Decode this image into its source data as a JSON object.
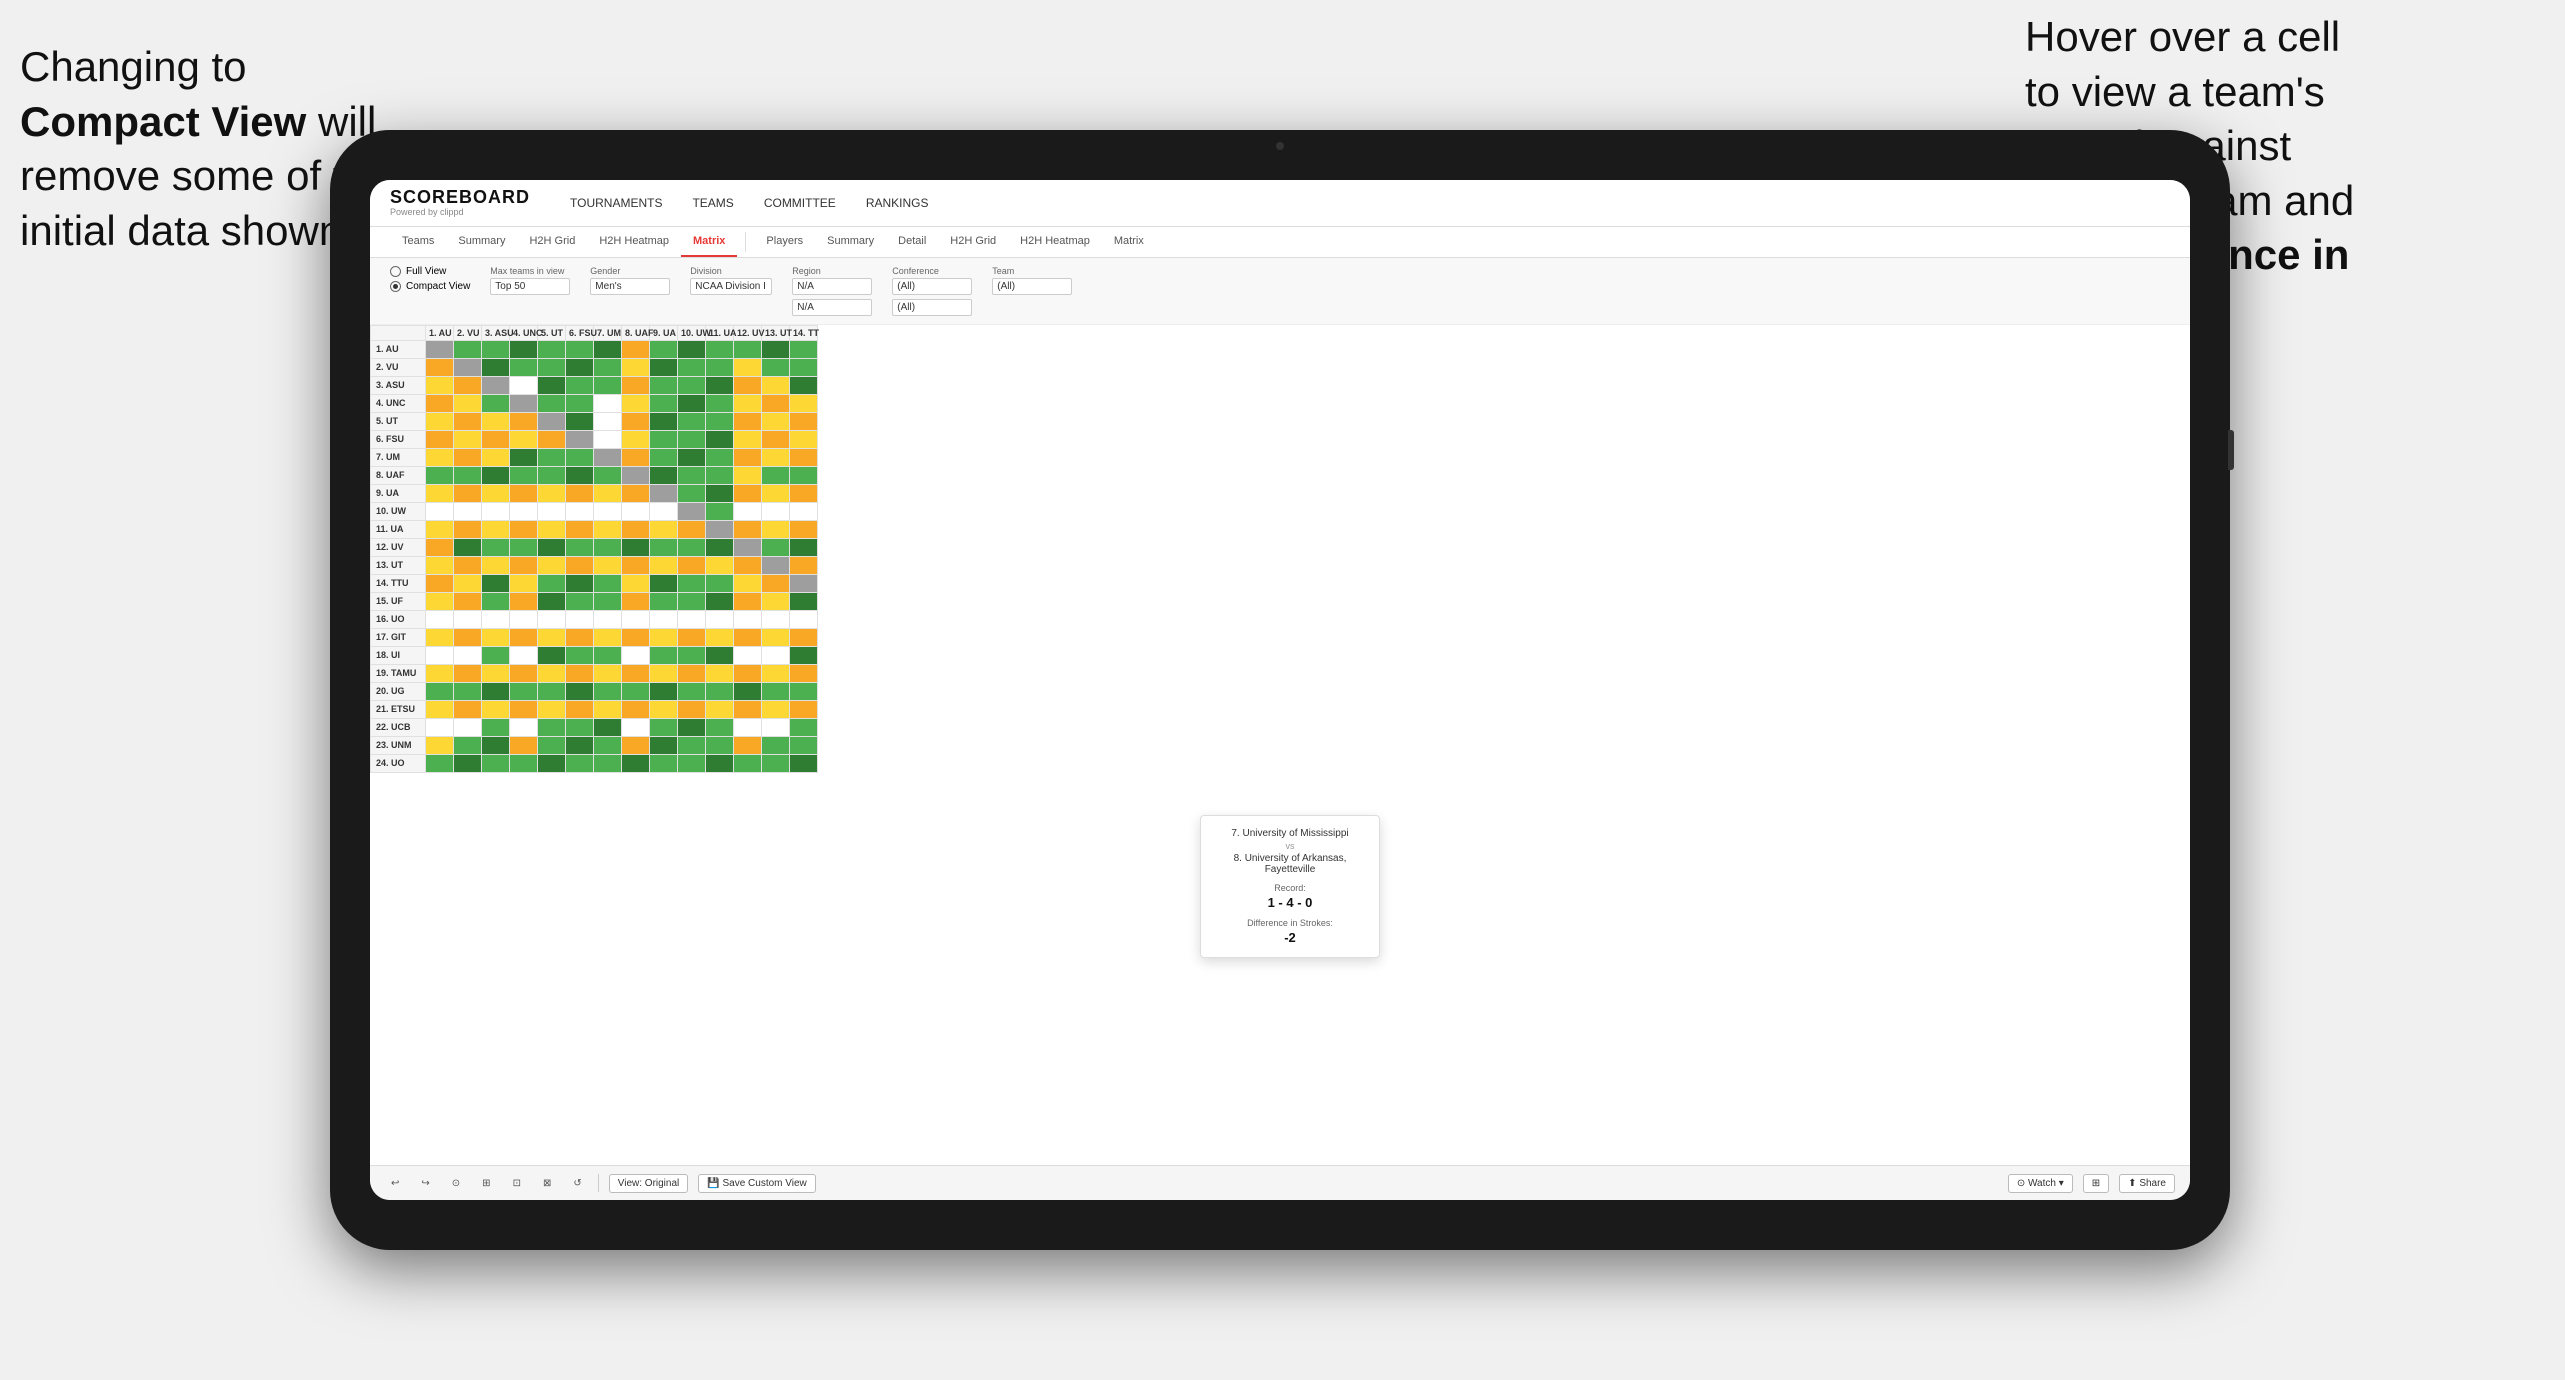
{
  "annotations": {
    "left_title": "Changing to",
    "left_bold": "Compact View",
    "left_text": " will\nremove some of the\ninitial data shown",
    "right_text": "Hover over a cell\nto view a team's\nrecord against\nanother team and\nthe ",
    "right_bold": "Difference in\nStrokes"
  },
  "app": {
    "logo": "SCOREBOARD",
    "logo_sub": "Powered by clippd",
    "nav": [
      "TOURNAMENTS",
      "TEAMS",
      "COMMITTEE",
      "RANKINGS"
    ],
    "sub_tabs_group1": [
      "Teams",
      "Summary",
      "H2H Grid",
      "H2H Heatmap",
      "Matrix"
    ],
    "sub_tabs_group2": [
      "Players",
      "Summary",
      "Detail",
      "H2H Grid",
      "H2H Heatmap",
      "Matrix"
    ],
    "active_tab": "Matrix"
  },
  "controls": {
    "view_full": "Full View",
    "view_compact": "Compact View",
    "compact_selected": true,
    "filters": [
      {
        "label": "Max teams in view",
        "value": "Top 50"
      },
      {
        "label": "Gender",
        "value": "Men's"
      },
      {
        "label": "Division",
        "value": "NCAA Division I"
      },
      {
        "label": "Region",
        "value": "N/A",
        "value2": "N/A"
      },
      {
        "label": "Conference",
        "value": "(All)",
        "value2": "(All)"
      },
      {
        "label": "Team",
        "value": "(All)"
      }
    ]
  },
  "matrix": {
    "col_headers": [
      "1. AU",
      "2. VU",
      "3. ASU",
      "4. UNC",
      "5. UT",
      "6. FSU",
      "7. UM",
      "8. UAF",
      "9. UA",
      "10. UW",
      "11. UA",
      "12. UV",
      "13. UT",
      "14. TT"
    ],
    "rows": [
      {
        "label": "1. AU",
        "cells": [
          "self",
          "g",
          "g",
          "g",
          "g",
          "g",
          "g",
          "y",
          "g",
          "g",
          "g",
          "g",
          "g",
          "g"
        ]
      },
      {
        "label": "2. VU",
        "cells": [
          "y",
          "self",
          "g",
          "g",
          "g",
          "g",
          "g",
          "y",
          "g",
          "g",
          "g",
          "y",
          "g",
          "g"
        ]
      },
      {
        "label": "3. ASU",
        "cells": [
          "y",
          "y",
          "self",
          "w",
          "g",
          "g",
          "g",
          "y",
          "g",
          "g",
          "g",
          "y",
          "y",
          "g"
        ]
      },
      {
        "label": "4. UNC",
        "cells": [
          "y",
          "y",
          "g",
          "self",
          "g",
          "g",
          "w",
          "y",
          "g",
          "g",
          "g",
          "y",
          "y",
          "y"
        ]
      },
      {
        "label": "5. UT",
        "cells": [
          "y",
          "y",
          "y",
          "y",
          "self",
          "g",
          "w",
          "y",
          "g",
          "g",
          "g",
          "y",
          "y",
          "y"
        ]
      },
      {
        "label": "6. FSU",
        "cells": [
          "y",
          "y",
          "y",
          "y",
          "y",
          "self",
          "w",
          "y",
          "g",
          "g",
          "g",
          "y",
          "y",
          "y"
        ]
      },
      {
        "label": "7. UM",
        "cells": [
          "y",
          "y",
          "y",
          "g",
          "g",
          "g",
          "self",
          "y",
          "g",
          "g",
          "g",
          "y",
          "y",
          "y"
        ]
      },
      {
        "label": "8. UAF",
        "cells": [
          "g",
          "g",
          "g",
          "g",
          "g",
          "g",
          "g",
          "self",
          "g",
          "g",
          "g",
          "y",
          "g",
          "g"
        ]
      },
      {
        "label": "9. UA",
        "cells": [
          "y",
          "y",
          "y",
          "y",
          "y",
          "y",
          "y",
          "y",
          "self",
          "g",
          "g",
          "y",
          "y",
          "y"
        ]
      },
      {
        "label": "10. UW",
        "cells": [
          "w",
          "w",
          "w",
          "w",
          "w",
          "w",
          "w",
          "w",
          "w",
          "self",
          "g",
          "w",
          "w",
          "w"
        ]
      },
      {
        "label": "11. UA",
        "cells": [
          "y",
          "y",
          "y",
          "y",
          "y",
          "y",
          "y",
          "y",
          "y",
          "y",
          "self",
          "y",
          "y",
          "y"
        ]
      },
      {
        "label": "12. UV",
        "cells": [
          "y",
          "g",
          "g",
          "g",
          "g",
          "g",
          "g",
          "g",
          "g",
          "g",
          "g",
          "self",
          "g",
          "g"
        ]
      },
      {
        "label": "13. UT",
        "cells": [
          "y",
          "y",
          "y",
          "y",
          "y",
          "y",
          "y",
          "y",
          "y",
          "y",
          "y",
          "y",
          "self",
          "y"
        ]
      },
      {
        "label": "14. TTU",
        "cells": [
          "y",
          "y",
          "g",
          "y",
          "g",
          "g",
          "g",
          "y",
          "g",
          "g",
          "g",
          "y",
          "y",
          "self"
        ]
      },
      {
        "label": "15. UF",
        "cells": [
          "y",
          "y",
          "g",
          "y",
          "g",
          "g",
          "g",
          "y",
          "g",
          "g",
          "g",
          "y",
          "y",
          "g"
        ]
      },
      {
        "label": "16. UO",
        "cells": [
          "w",
          "w",
          "w",
          "w",
          "w",
          "w",
          "w",
          "w",
          "w",
          "w",
          "w",
          "w",
          "w",
          "w"
        ]
      },
      {
        "label": "17. GIT",
        "cells": [
          "y",
          "y",
          "y",
          "y",
          "y",
          "y",
          "y",
          "y",
          "y",
          "y",
          "y",
          "y",
          "y",
          "y"
        ]
      },
      {
        "label": "18. UI",
        "cells": [
          "w",
          "w",
          "g",
          "w",
          "g",
          "g",
          "g",
          "w",
          "g",
          "g",
          "g",
          "w",
          "w",
          "g"
        ]
      },
      {
        "label": "19. TAMU",
        "cells": [
          "y",
          "y",
          "y",
          "y",
          "y",
          "y",
          "y",
          "y",
          "y",
          "y",
          "y",
          "y",
          "y",
          "y"
        ]
      },
      {
        "label": "20. UG",
        "cells": [
          "g",
          "g",
          "g",
          "g",
          "g",
          "g",
          "g",
          "g",
          "g",
          "g",
          "g",
          "g",
          "g",
          "g"
        ]
      },
      {
        "label": "21. ETSU",
        "cells": [
          "y",
          "y",
          "y",
          "y",
          "y",
          "y",
          "y",
          "y",
          "y",
          "y",
          "y",
          "y",
          "y",
          "y"
        ]
      },
      {
        "label": "22. UCB",
        "cells": [
          "w",
          "w",
          "g",
          "w",
          "g",
          "g",
          "g",
          "w",
          "g",
          "g",
          "g",
          "w",
          "w",
          "g"
        ]
      },
      {
        "label": "23. UNM",
        "cells": [
          "y",
          "g",
          "g",
          "y",
          "g",
          "g",
          "g",
          "y",
          "g",
          "g",
          "g",
          "y",
          "g",
          "g"
        ]
      },
      {
        "label": "24. UO",
        "cells": [
          "g",
          "g",
          "g",
          "g",
          "g",
          "g",
          "g",
          "g",
          "g",
          "g",
          "g",
          "g",
          "g",
          "g"
        ]
      }
    ]
  },
  "tooltip": {
    "team1": "7. University of Mississippi",
    "vs": "vs",
    "team2": "8. University of Arkansas, Fayetteville",
    "record_label": "Record:",
    "record": "1 - 4 - 0",
    "strokes_label": "Difference in Strokes:",
    "strokes": "-2"
  },
  "toolbar": {
    "buttons": [
      "↩",
      "↪",
      "⊙",
      "⊞",
      "⊡",
      "✕",
      "↺"
    ],
    "view_original": "View: Original",
    "save_custom": "Save Custom View",
    "watch": "Watch",
    "share": "Share"
  }
}
